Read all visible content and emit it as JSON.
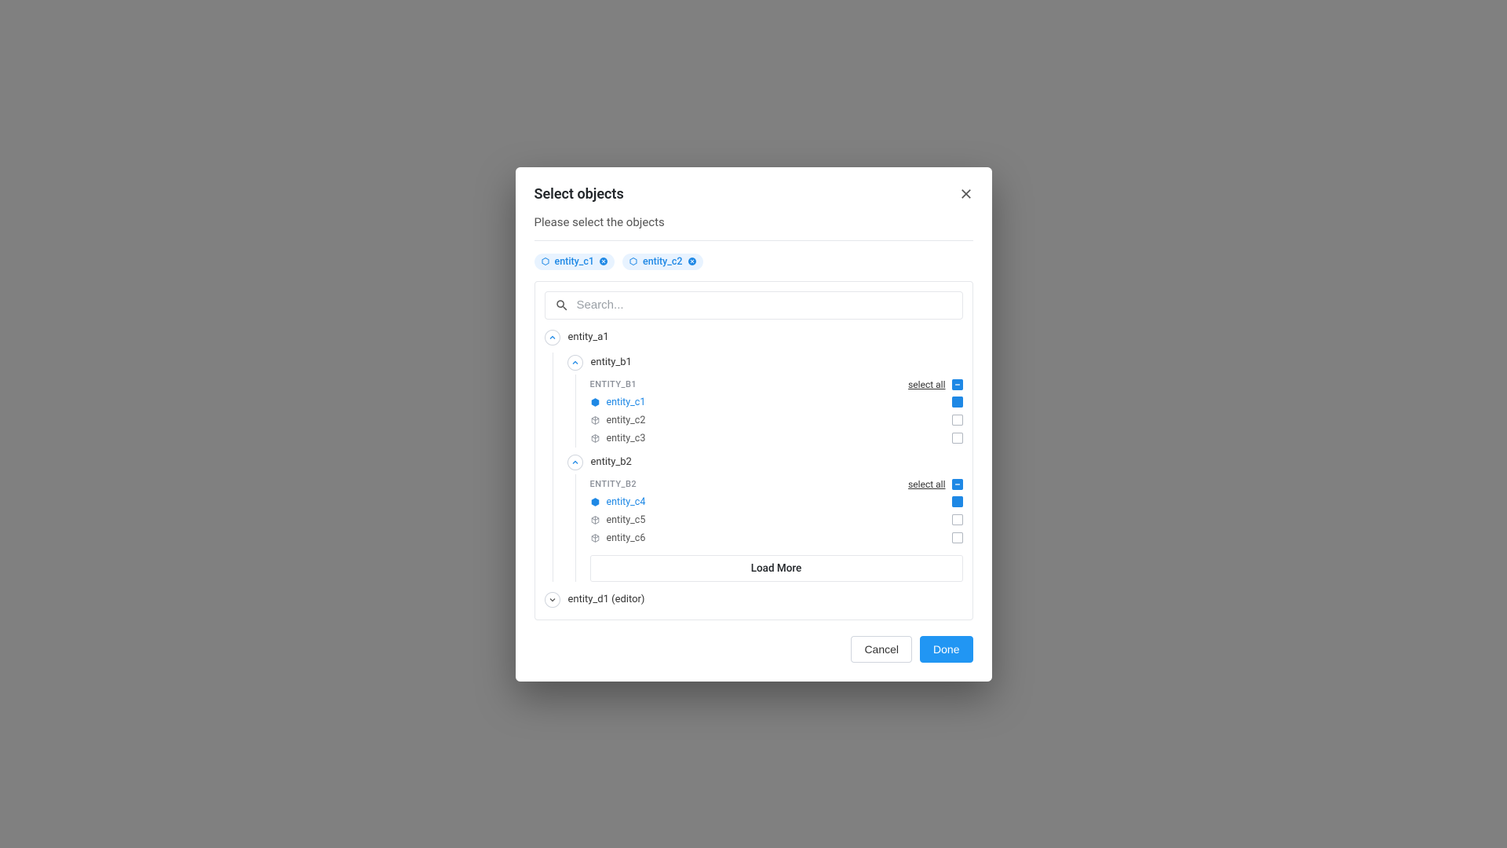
{
  "dialog": {
    "title": "Select objects",
    "subtitle": "Please select the objects",
    "search_placeholder": "Search...",
    "select_all_label": "select all",
    "load_more_label": "Load More",
    "cancel_label": "Cancel",
    "done_label": "Done"
  },
  "chips": [
    {
      "label": "entity_c1"
    },
    {
      "label": "entity_c2"
    }
  ],
  "tree": {
    "a1": {
      "label": "entity_a1",
      "expanded": true,
      "b1": {
        "label": "entity_b1",
        "group_title": "ENTITY_B1",
        "expanded": true,
        "items": [
          {
            "label": "entity_c1",
            "checked": true
          },
          {
            "label": "entity_c2",
            "checked": false
          },
          {
            "label": "entity_c3",
            "checked": false
          }
        ]
      },
      "b2": {
        "label": "entity_b2",
        "group_title": "ENTITY_B2",
        "expanded": true,
        "items": [
          {
            "label": "entity_c4",
            "checked": true
          },
          {
            "label": "entity_c5",
            "checked": false
          },
          {
            "label": "entity_c6",
            "checked": false
          }
        ]
      }
    },
    "d1": {
      "label": "entity_d1 (editor)",
      "expanded": false
    }
  }
}
